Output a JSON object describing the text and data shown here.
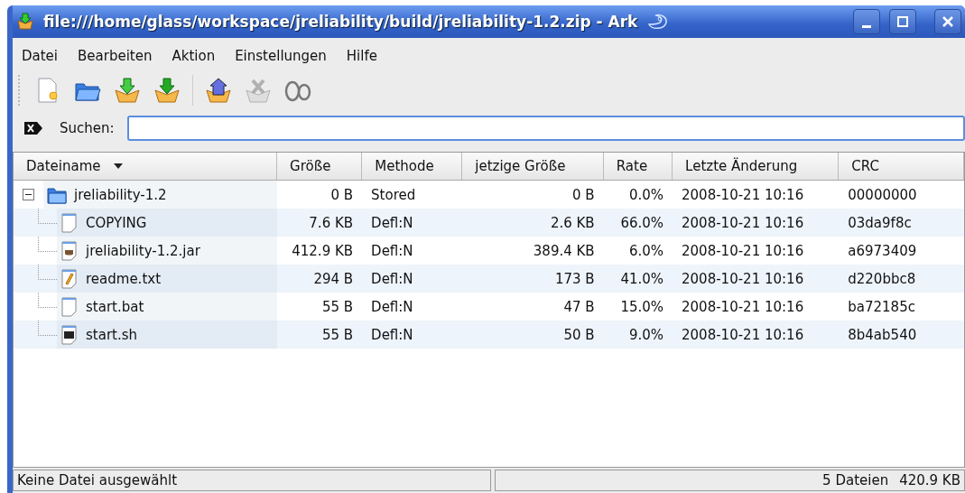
{
  "window": {
    "title": "file:///home/glass/workspace/jreliability/build/jreliability-1.2.zip - Ark"
  },
  "menu": [
    "Datei",
    "Bearbeiten",
    "Aktion",
    "Einstellungen",
    "Hilfe"
  ],
  "toolbar": [
    {
      "kind": "new",
      "disabled": false
    },
    {
      "kind": "open",
      "disabled": false
    },
    {
      "kind": "extract",
      "disabled": false
    },
    {
      "kind": "add",
      "disabled": false
    },
    {
      "kind": "sep"
    },
    {
      "kind": "upload",
      "disabled": false
    },
    {
      "kind": "delete",
      "disabled": true
    },
    {
      "kind": "view",
      "disabled": false
    }
  ],
  "search": {
    "label": "Suchen:"
  },
  "table": {
    "columns": [
      {
        "label": "Dateiname",
        "sorted": true
      },
      {
        "label": "Größe",
        "sorted": false
      },
      {
        "label": "Methode",
        "sorted": false
      },
      {
        "label": "jetzige Größe",
        "sorted": false
      },
      {
        "label": "Rate",
        "sorted": false
      },
      {
        "label": "Letzte Änderung",
        "sorted": false
      },
      {
        "label": "CRC",
        "sorted": false
      }
    ],
    "rows": [
      {
        "name": "jreliability-1.2",
        "kind": "folder",
        "expanded": true,
        "size": "0 B",
        "method": "Stored",
        "packed": "0 B",
        "rate": "0.0%",
        "modified": "2008-10-21 10:16",
        "crc": "00000000",
        "children": [
          {
            "name": "COPYING",
            "kind": "text",
            "size": "7.6 KB",
            "method": "Defl:N",
            "packed": "2.6 KB",
            "rate": "66.0%",
            "modified": "2008-10-21 10:16",
            "crc": "03da9f8c"
          },
          {
            "name": "jreliability-1.2.jar",
            "kind": "jar",
            "size": "412.9 KB",
            "method": "Defl:N",
            "packed": "389.4 KB",
            "rate": "6.0%",
            "modified": "2008-10-21 10:16",
            "crc": "a6973409"
          },
          {
            "name": "readme.txt",
            "kind": "note",
            "size": "294 B",
            "method": "Defl:N",
            "packed": "173 B",
            "rate": "41.0%",
            "modified": "2008-10-21 10:16",
            "crc": "d220bbc8"
          },
          {
            "name": "start.bat",
            "kind": "text",
            "size": "55 B",
            "method": "Defl:N",
            "packed": "47 B",
            "rate": "15.0%",
            "modified": "2008-10-21 10:16",
            "crc": "ba72185c"
          },
          {
            "name": "start.sh",
            "kind": "script",
            "size": "55 B",
            "method": "Defl:N",
            "packed": "50 B",
            "rate": "9.0%",
            "modified": "2008-10-21 10:16",
            "crc": "8b4ab540"
          }
        ]
      }
    ]
  },
  "status_bar": {
    "left": "Keine Datei ausgewählt",
    "files": "5 Dateien",
    "total": "420.9 KB"
  }
}
